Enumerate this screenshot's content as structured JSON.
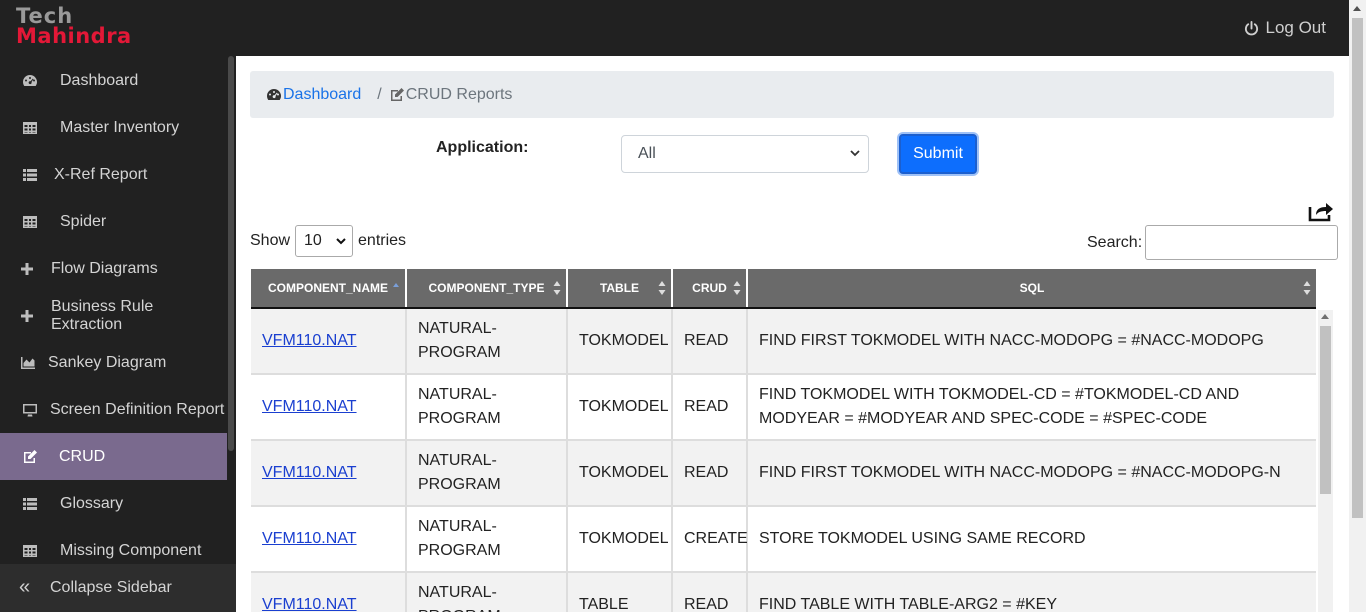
{
  "header": {
    "logo_line1": "Tech",
    "logo_line2": "Mahindra",
    "logout_label": "Log Out"
  },
  "sidebar": {
    "items": [
      {
        "label": "Dashboard",
        "icon": "dashboard-icon"
      },
      {
        "label": "Master Inventory",
        "icon": "table-icon"
      },
      {
        "label": "X-Ref Report",
        "icon": "list-icon"
      },
      {
        "label": "Spider",
        "icon": "table-icon"
      },
      {
        "label": "Flow Diagrams",
        "icon": "plus-icon"
      },
      {
        "label": "Business Rule Extraction",
        "icon": "plus-icon"
      },
      {
        "label": "Sankey Diagram",
        "icon": "area-chart-icon"
      },
      {
        "label": "Screen Definition Report",
        "icon": "desktop-icon"
      },
      {
        "label": "CRUD",
        "icon": "edit-icon",
        "active": true
      },
      {
        "label": "Glossary",
        "icon": "list-icon"
      },
      {
        "label": "Missing Component",
        "icon": "table-icon"
      }
    ],
    "collapse_label": "Collapse Sidebar"
  },
  "breadcrumb": {
    "home": "Dashboard",
    "separator": "/",
    "current": "CRUD Reports"
  },
  "filter": {
    "application_label": "Application:",
    "application_value": "All",
    "submit_label": "Submit"
  },
  "table_controls": {
    "show_label": "Show",
    "entries_value": "10",
    "entries_label": "entries",
    "search_label": "Search:",
    "search_value": ""
  },
  "table": {
    "columns": [
      "COMPONENT_NAME",
      "COMPONENT_TYPE",
      "TABLE",
      "CRUD",
      "SQL"
    ],
    "rows": [
      {
        "component_name": "VFM110.NAT",
        "component_type": "NATURAL-PROGRAM",
        "table": "TOKMODEL",
        "crud": "READ",
        "sql": "FIND FIRST TOKMODEL WITH NACC-MODOPG = #NACC-MODOPG"
      },
      {
        "component_name": "VFM110.NAT",
        "component_type": "NATURAL-PROGRAM",
        "table": "TOKMODEL",
        "crud": "READ",
        "sql": "FIND TOKMODEL WITH TOKMODEL-CD = #TOKMODEL-CD AND MODYEAR = #MODYEAR AND SPEC-CODE = #SPEC-CODE"
      },
      {
        "component_name": "VFM110.NAT",
        "component_type": "NATURAL-PROGRAM",
        "table": "TOKMODEL",
        "crud": "READ",
        "sql": "FIND FIRST TOKMODEL WITH NACC-MODOPG = #NACC-MODOPG-N"
      },
      {
        "component_name": "VFM110.NAT",
        "component_type": "NATURAL-PROGRAM",
        "table": "TOKMODEL",
        "crud": "CREATE",
        "sql": "STORE TOKMODEL USING SAME RECORD"
      },
      {
        "component_name": "VFM110.NAT",
        "component_type": "NATURAL-PROGRAM",
        "table": "TABLE",
        "crud": "READ",
        "sql": "FIND TABLE WITH TABLE-ARG2 = #KEY"
      }
    ]
  },
  "colors": {
    "topbar": "#212121",
    "active_nav": "#7a6a8e",
    "link": "#1a73e8",
    "submit": "#0d6efd",
    "brand_red": "#e31837"
  }
}
